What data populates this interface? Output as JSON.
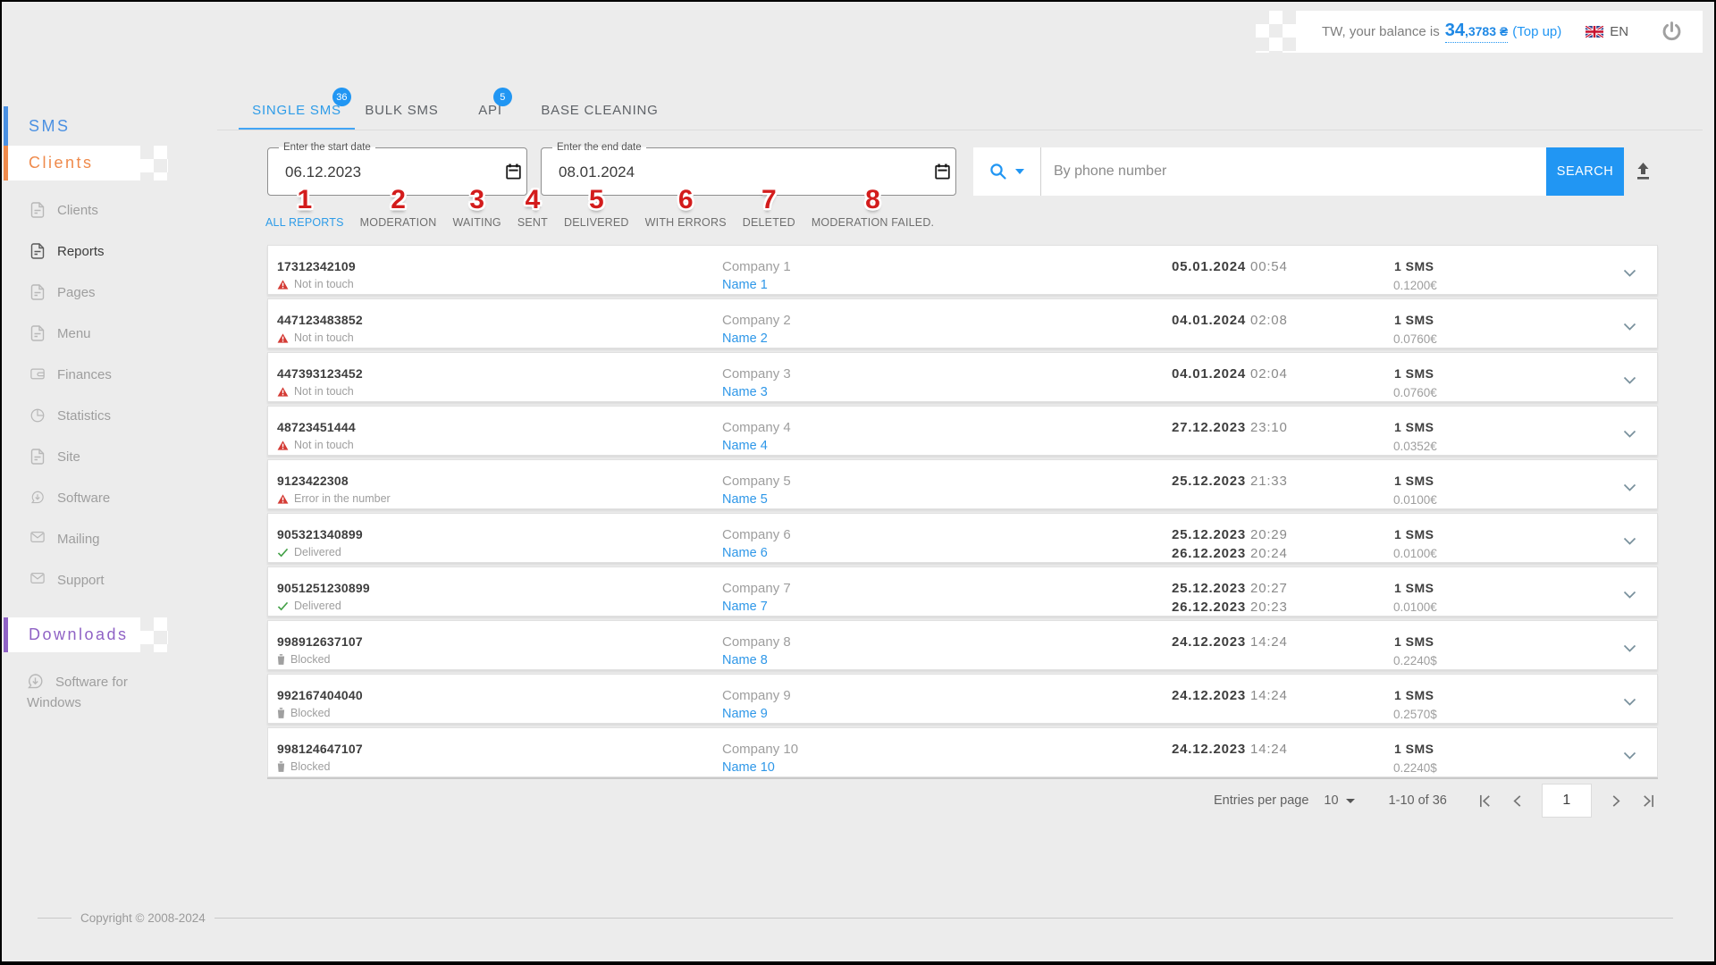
{
  "topbar": {
    "balance_prefix": "TW, your balance is",
    "balance_main": "34",
    "balance_fraction": ",3783 ₴",
    "topup_label": "(Top up)",
    "language": "EN"
  },
  "sidebar": {
    "sections": [
      {
        "label": "SMS",
        "color": "#4a90e2"
      },
      {
        "label": "Clients",
        "color": "#ef8a4b"
      },
      {
        "label": "Downloads",
        "color": "#8f62c5"
      }
    ],
    "items": [
      {
        "label": "Clients",
        "icon": "file",
        "active": false
      },
      {
        "label": "Reports",
        "icon": "file",
        "active": true
      },
      {
        "label": "Pages",
        "icon": "file",
        "active": false
      },
      {
        "label": "Menu",
        "icon": "file",
        "active": false
      },
      {
        "label": "Finances",
        "icon": "wallet",
        "active": false
      },
      {
        "label": "Statistics",
        "icon": "pie-chart",
        "active": false
      },
      {
        "label": "Site",
        "icon": "file",
        "active": false
      },
      {
        "label": "Software",
        "icon": "download-bubble",
        "active": false
      },
      {
        "label": "Mailing",
        "icon": "envelope",
        "active": false
      },
      {
        "label": "Support",
        "icon": "envelope",
        "active": false
      }
    ],
    "software_for_windows": "Software for Windows"
  },
  "tabs": [
    {
      "label": "SINGLE SMS",
      "badge": "36",
      "active": true
    },
    {
      "label": "BULK SMS",
      "badge": null,
      "active": false
    },
    {
      "label": "API",
      "badge": "5",
      "active": false
    },
    {
      "label": "BASE CLEANING",
      "badge": null,
      "active": false
    }
  ],
  "filter_bar": {
    "start_date_label": "Enter the start date",
    "start_date_value": "06.12.2023",
    "end_date_label": "Enter the end date",
    "end_date_value": "08.01.2024",
    "search_placeholder": "By phone number",
    "search_button_label": "SEARCH"
  },
  "filters": [
    {
      "num": "1",
      "label": "ALL REPORTS",
      "active": true
    },
    {
      "num": "2",
      "label": "MODERATION",
      "active": false
    },
    {
      "num": "3",
      "label": "WAITING",
      "active": false
    },
    {
      "num": "4",
      "label": "SENT",
      "active": false
    },
    {
      "num": "5",
      "label": "DELIVERED",
      "active": false
    },
    {
      "num": "6",
      "label": "WITH ERRORS",
      "active": false
    },
    {
      "num": "7",
      "label": "DELETED",
      "active": false
    },
    {
      "num": "8",
      "label": "MODERATION FAILED.",
      "active": false
    }
  ],
  "table": {
    "rows": [
      {
        "phone": "17312342109",
        "status": "Not in touch",
        "status_icon": "warning",
        "company": "Company 1",
        "name": "Name 1",
        "dates": [
          {
            "d": "05.01.2024",
            "t": "00:54"
          }
        ],
        "sms": "1 SMS",
        "price": "0.1200€"
      },
      {
        "phone": "447123483852",
        "status": "Not in touch",
        "status_icon": "warning",
        "company": "Company 2",
        "name": "Name 2",
        "dates": [
          {
            "d": "04.01.2024",
            "t": "02:08"
          }
        ],
        "sms": "1 SMS",
        "price": "0.0760€"
      },
      {
        "phone": "447393123452",
        "status": "Not in touch",
        "status_icon": "warning",
        "company": "Company 3",
        "name": "Name 3",
        "dates": [
          {
            "d": "04.01.2024",
            "t": "02:04"
          }
        ],
        "sms": "1 SMS",
        "price": "0.0760€"
      },
      {
        "phone": "48723451444",
        "status": "Not in touch",
        "status_icon": "warning",
        "company": "Company 4",
        "name": "Name 4",
        "dates": [
          {
            "d": "27.12.2023",
            "t": "23:10"
          }
        ],
        "sms": "1 SMS",
        "price": "0.0352€"
      },
      {
        "phone": "9123422308",
        "status": "Error in the number",
        "status_icon": "warning",
        "company": "Company 5",
        "name": "Name 5",
        "dates": [
          {
            "d": "25.12.2023",
            "t": "21:33"
          }
        ],
        "sms": "1 SMS",
        "price": "0.0100€"
      },
      {
        "phone": "905321340899",
        "status": "Delivered",
        "status_icon": "check",
        "company": "Company 6",
        "name": "Name 6",
        "dates": [
          {
            "d": "25.12.2023",
            "t": "20:29"
          },
          {
            "d": "26.12.2023",
            "t": "20:24"
          }
        ],
        "sms": "1 SMS",
        "price": "0.0100€"
      },
      {
        "phone": "9051251230899",
        "status": "Delivered",
        "status_icon": "check",
        "company": "Company 7",
        "name": "Name 7",
        "dates": [
          {
            "d": "25.12.2023",
            "t": "20:27"
          },
          {
            "d": "26.12.2023",
            "t": "20:23"
          }
        ],
        "sms": "1 SMS",
        "price": "0.0100€"
      },
      {
        "phone": "998912637107",
        "status": "Blocked",
        "status_icon": "blocked",
        "company": "Company 8",
        "name": "Name 8",
        "dates": [
          {
            "d": "24.12.2023",
            "t": "14:24"
          }
        ],
        "sms": "1 SMS",
        "price": "0.2240$"
      },
      {
        "phone": "992167404040",
        "status": "Blocked",
        "status_icon": "blocked",
        "company": "Company 9",
        "name": "Name 9",
        "dates": [
          {
            "d": "24.12.2023",
            "t": "14:24"
          }
        ],
        "sms": "1 SMS",
        "price": "0.2570$"
      },
      {
        "phone": "998124647107",
        "status": "Blocked",
        "status_icon": "blocked",
        "company": "Company 10",
        "name": "Name 10",
        "dates": [
          {
            "d": "24.12.2023",
            "t": "14:24"
          }
        ],
        "sms": "1 SMS",
        "price": "0.2240$"
      }
    ]
  },
  "pagination": {
    "entries_label": "Entries per page",
    "per_page": "10",
    "range": "1-10 of 36",
    "page": "1"
  },
  "footer": {
    "copyright": "Copyright © 2008-2024"
  }
}
